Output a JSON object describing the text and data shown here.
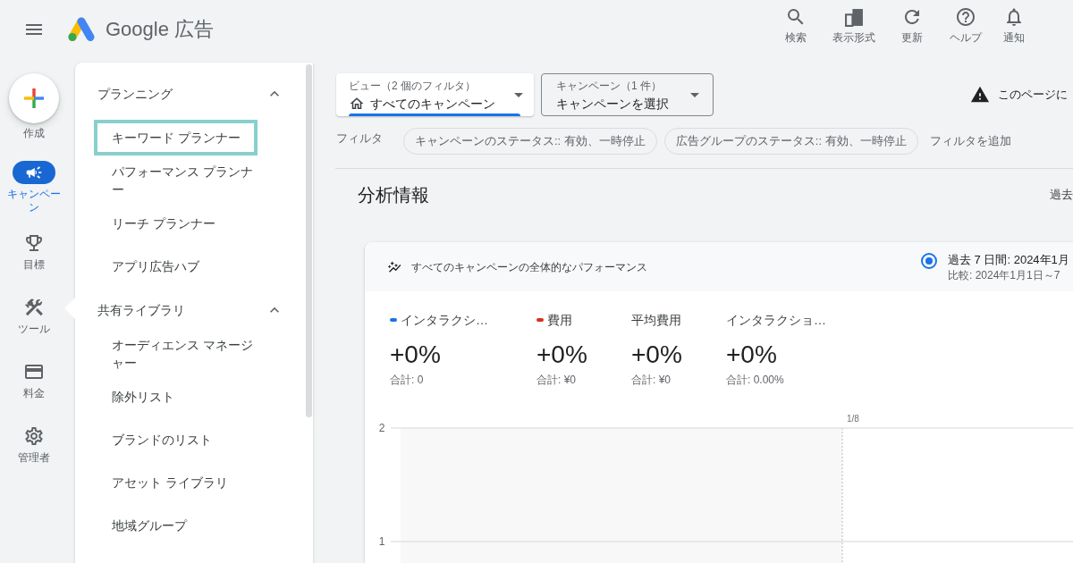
{
  "header": {
    "product_name": "Google 広告",
    "actions": [
      {
        "kind": "search",
        "label": "検索"
      },
      {
        "kind": "appearance",
        "label": "表示形式"
      },
      {
        "kind": "refresh",
        "label": "更新"
      },
      {
        "kind": "help",
        "label": "ヘルプ"
      },
      {
        "kind": "notifications",
        "label": "通知"
      }
    ]
  },
  "nav_rail": {
    "create_label": "作成",
    "items": [
      {
        "kind": "campaigns",
        "label": "キャンペーン",
        "selected": true,
        "expanded": false
      },
      {
        "kind": "goals",
        "label": "目標",
        "selected": false,
        "expanded": false
      },
      {
        "kind": "tools",
        "label": "ツール",
        "selected": false,
        "expanded": true
      },
      {
        "kind": "billing",
        "label": "料金",
        "selected": false,
        "expanded": false
      },
      {
        "kind": "admin",
        "label": "管理者",
        "selected": false,
        "expanded": false
      }
    ]
  },
  "tools_panel": {
    "sections": [
      {
        "title": "プランニング",
        "expanded": true,
        "items": [
          {
            "label": "キーワード プランナー",
            "highlighted": true
          },
          {
            "label": "パフォーマンス プランナー",
            "highlighted": false
          },
          {
            "label": "リーチ プランナー",
            "highlighted": false
          },
          {
            "label": "アプリ広告ハブ",
            "highlighted": false
          }
        ]
      },
      {
        "title": "共有ライブラリ",
        "expanded": true,
        "items": [
          {
            "label": "オーディエンス マネージャー",
            "highlighted": false
          },
          {
            "label": "除外リスト",
            "highlighted": false
          },
          {
            "label": "ブランドのリスト",
            "highlighted": false
          },
          {
            "label": "アセット ライブラリ",
            "highlighted": false
          },
          {
            "label": "地域グループ",
            "highlighted": false
          }
        ]
      }
    ]
  },
  "view_selector": {
    "label": "ビュー（2 個のフィルタ）",
    "value": "すべてのキャンペーン",
    "focused": true
  },
  "campaign_selector": {
    "label": "キャンペーン（1 件）",
    "value": "キャンペーンを選択"
  },
  "notice": {
    "text": "このページに"
  },
  "filters": {
    "label": "フィルタ",
    "chips": [
      "キャンペーンのステータス:: 有効、一時停止",
      "広告グループのステータス:: 有効、一時停止"
    ],
    "add_label": "フィルタを追加"
  },
  "insights": {
    "title": "分析情報",
    "date_range": "過去",
    "card": {
      "title": "すべてのキャンペーンの全体的なパフォーマンス",
      "period": {
        "selected": true,
        "label": "過去 7 日間: 2024年1月",
        "comparison": "比較: 2024年1月1日～7"
      },
      "metrics": [
        {
          "label": "インタラクシ…",
          "color": "#1a73e8",
          "change": "+0%",
          "total": "合計: 0"
        },
        {
          "label": "費用",
          "color": "#d93025",
          "change": "+0%",
          "total": "合計: ¥0"
        },
        {
          "label": "平均費用",
          "change": "+0%",
          "total": "合計: ¥0"
        },
        {
          "label": "インタラクショ…",
          "change": "+0%",
          "total": "合計: 0.00%"
        }
      ],
      "chart_data": {
        "type": "line",
        "x": [
          "1/8"
        ],
        "ylim": [
          0.8,
          2
        ],
        "yticks": [
          1,
          2
        ]
      }
    }
  }
}
